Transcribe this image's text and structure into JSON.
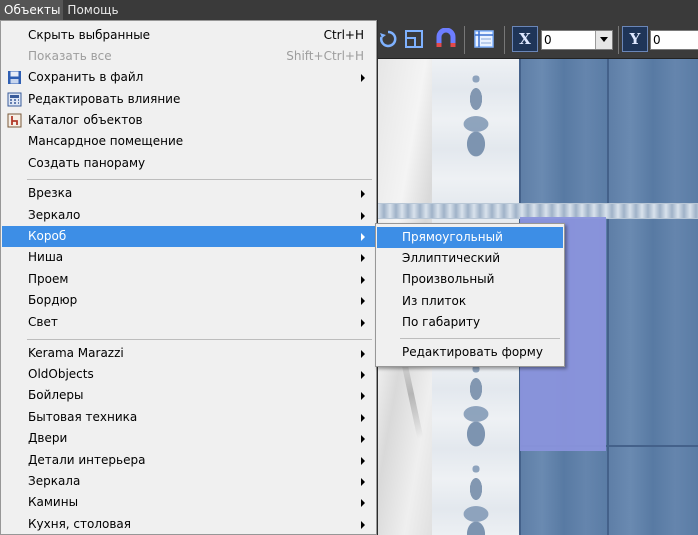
{
  "menubar": {
    "items": [
      "Объекты",
      "Помощь"
    ]
  },
  "toolbar": {
    "x_label": "X",
    "x_value": "0",
    "y_label": "Y",
    "y_value": "0"
  },
  "menu": {
    "items": [
      {
        "label": "Скрыть выбранные",
        "shortcut": "Ctrl+H"
      },
      {
        "label": "Показать все",
        "shortcut": "Shift+Ctrl+H"
      },
      {
        "label": "Сохранить в файл"
      },
      {
        "label": "Редактировать влияние"
      },
      {
        "label": "Каталог объектов"
      },
      {
        "label": "Мансардное помещение"
      },
      {
        "label": "Создать панораму"
      },
      {
        "label": "Врезка"
      },
      {
        "label": "Зеркало"
      },
      {
        "label": "Короб"
      },
      {
        "label": "Ниша"
      },
      {
        "label": "Проем"
      },
      {
        "label": "Бордюр"
      },
      {
        "label": "Свет"
      },
      {
        "label": "Kerama Marazzi"
      },
      {
        "label": "OldObjects"
      },
      {
        "label": "Бойлеры"
      },
      {
        "label": "Бытовая техника"
      },
      {
        "label": "Двери"
      },
      {
        "label": "Детали интерьера"
      },
      {
        "label": "Зеркала"
      },
      {
        "label": "Камины"
      },
      {
        "label": "Кухня, столовая"
      }
    ]
  },
  "submenu": {
    "items": [
      {
        "label": "Прямоугольный"
      },
      {
        "label": "Эллиптический"
      },
      {
        "label": "Произвольный"
      },
      {
        "label": "Из плиток"
      },
      {
        "label": "По габариту"
      },
      {
        "label": "Редактировать форму"
      }
    ]
  },
  "colors": {
    "selection": "#3d8ee6",
    "menu_bg": "#f0f0f0",
    "highlight_tile": "#8a93dc"
  }
}
